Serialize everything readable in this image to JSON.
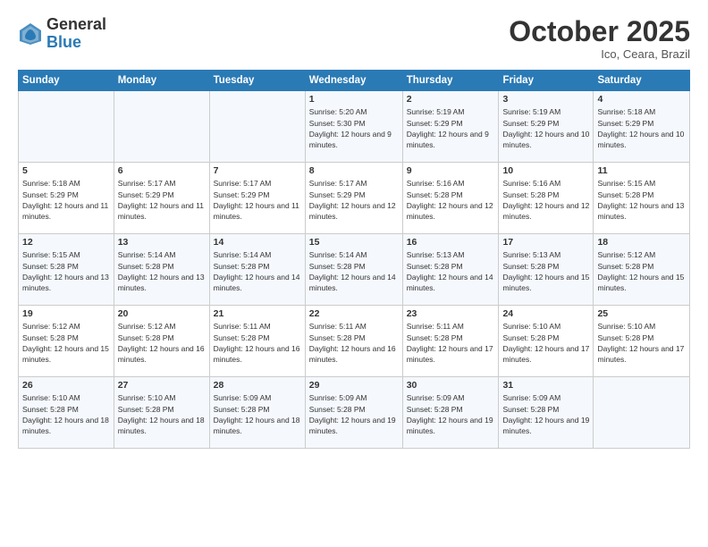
{
  "header": {
    "logo_general": "General",
    "logo_blue": "Blue",
    "month_title": "October 2025",
    "location": "Ico, Ceara, Brazil"
  },
  "weekdays": [
    "Sunday",
    "Monday",
    "Tuesday",
    "Wednesday",
    "Thursday",
    "Friday",
    "Saturday"
  ],
  "rows": [
    [
      {
        "day": "",
        "sunrise": "",
        "sunset": "",
        "daylight": ""
      },
      {
        "day": "",
        "sunrise": "",
        "sunset": "",
        "daylight": ""
      },
      {
        "day": "",
        "sunrise": "",
        "sunset": "",
        "daylight": ""
      },
      {
        "day": "1",
        "sunrise": "Sunrise: 5:20 AM",
        "sunset": "Sunset: 5:30 PM",
        "daylight": "Daylight: 12 hours and 9 minutes."
      },
      {
        "day": "2",
        "sunrise": "Sunrise: 5:19 AM",
        "sunset": "Sunset: 5:29 PM",
        "daylight": "Daylight: 12 hours and 9 minutes."
      },
      {
        "day": "3",
        "sunrise": "Sunrise: 5:19 AM",
        "sunset": "Sunset: 5:29 PM",
        "daylight": "Daylight: 12 hours and 10 minutes."
      },
      {
        "day": "4",
        "sunrise": "Sunrise: 5:18 AM",
        "sunset": "Sunset: 5:29 PM",
        "daylight": "Daylight: 12 hours and 10 minutes."
      }
    ],
    [
      {
        "day": "5",
        "sunrise": "Sunrise: 5:18 AM",
        "sunset": "Sunset: 5:29 PM",
        "daylight": "Daylight: 12 hours and 11 minutes."
      },
      {
        "day": "6",
        "sunrise": "Sunrise: 5:17 AM",
        "sunset": "Sunset: 5:29 PM",
        "daylight": "Daylight: 12 hours and 11 minutes."
      },
      {
        "day": "7",
        "sunrise": "Sunrise: 5:17 AM",
        "sunset": "Sunset: 5:29 PM",
        "daylight": "Daylight: 12 hours and 11 minutes."
      },
      {
        "day": "8",
        "sunrise": "Sunrise: 5:17 AM",
        "sunset": "Sunset: 5:29 PM",
        "daylight": "Daylight: 12 hours and 12 minutes."
      },
      {
        "day": "9",
        "sunrise": "Sunrise: 5:16 AM",
        "sunset": "Sunset: 5:28 PM",
        "daylight": "Daylight: 12 hours and 12 minutes."
      },
      {
        "day": "10",
        "sunrise": "Sunrise: 5:16 AM",
        "sunset": "Sunset: 5:28 PM",
        "daylight": "Daylight: 12 hours and 12 minutes."
      },
      {
        "day": "11",
        "sunrise": "Sunrise: 5:15 AM",
        "sunset": "Sunset: 5:28 PM",
        "daylight": "Daylight: 12 hours and 13 minutes."
      }
    ],
    [
      {
        "day": "12",
        "sunrise": "Sunrise: 5:15 AM",
        "sunset": "Sunset: 5:28 PM",
        "daylight": "Daylight: 12 hours and 13 minutes."
      },
      {
        "day": "13",
        "sunrise": "Sunrise: 5:14 AM",
        "sunset": "Sunset: 5:28 PM",
        "daylight": "Daylight: 12 hours and 13 minutes."
      },
      {
        "day": "14",
        "sunrise": "Sunrise: 5:14 AM",
        "sunset": "Sunset: 5:28 PM",
        "daylight": "Daylight: 12 hours and 14 minutes."
      },
      {
        "day": "15",
        "sunrise": "Sunrise: 5:14 AM",
        "sunset": "Sunset: 5:28 PM",
        "daylight": "Daylight: 12 hours and 14 minutes."
      },
      {
        "day": "16",
        "sunrise": "Sunrise: 5:13 AM",
        "sunset": "Sunset: 5:28 PM",
        "daylight": "Daylight: 12 hours and 14 minutes."
      },
      {
        "day": "17",
        "sunrise": "Sunrise: 5:13 AM",
        "sunset": "Sunset: 5:28 PM",
        "daylight": "Daylight: 12 hours and 15 minutes."
      },
      {
        "day": "18",
        "sunrise": "Sunrise: 5:12 AM",
        "sunset": "Sunset: 5:28 PM",
        "daylight": "Daylight: 12 hours and 15 minutes."
      }
    ],
    [
      {
        "day": "19",
        "sunrise": "Sunrise: 5:12 AM",
        "sunset": "Sunset: 5:28 PM",
        "daylight": "Daylight: 12 hours and 15 minutes."
      },
      {
        "day": "20",
        "sunrise": "Sunrise: 5:12 AM",
        "sunset": "Sunset: 5:28 PM",
        "daylight": "Daylight: 12 hours and 16 minutes."
      },
      {
        "day": "21",
        "sunrise": "Sunrise: 5:11 AM",
        "sunset": "Sunset: 5:28 PM",
        "daylight": "Daylight: 12 hours and 16 minutes."
      },
      {
        "day": "22",
        "sunrise": "Sunrise: 5:11 AM",
        "sunset": "Sunset: 5:28 PM",
        "daylight": "Daylight: 12 hours and 16 minutes."
      },
      {
        "day": "23",
        "sunrise": "Sunrise: 5:11 AM",
        "sunset": "Sunset: 5:28 PM",
        "daylight": "Daylight: 12 hours and 17 minutes."
      },
      {
        "day": "24",
        "sunrise": "Sunrise: 5:10 AM",
        "sunset": "Sunset: 5:28 PM",
        "daylight": "Daylight: 12 hours and 17 minutes."
      },
      {
        "day": "25",
        "sunrise": "Sunrise: 5:10 AM",
        "sunset": "Sunset: 5:28 PM",
        "daylight": "Daylight: 12 hours and 17 minutes."
      }
    ],
    [
      {
        "day": "26",
        "sunrise": "Sunrise: 5:10 AM",
        "sunset": "Sunset: 5:28 PM",
        "daylight": "Daylight: 12 hours and 18 minutes."
      },
      {
        "day": "27",
        "sunrise": "Sunrise: 5:10 AM",
        "sunset": "Sunset: 5:28 PM",
        "daylight": "Daylight: 12 hours and 18 minutes."
      },
      {
        "day": "28",
        "sunrise": "Sunrise: 5:09 AM",
        "sunset": "Sunset: 5:28 PM",
        "daylight": "Daylight: 12 hours and 18 minutes."
      },
      {
        "day": "29",
        "sunrise": "Sunrise: 5:09 AM",
        "sunset": "Sunset: 5:28 PM",
        "daylight": "Daylight: 12 hours and 19 minutes."
      },
      {
        "day": "30",
        "sunrise": "Sunrise: 5:09 AM",
        "sunset": "Sunset: 5:28 PM",
        "daylight": "Daylight: 12 hours and 19 minutes."
      },
      {
        "day": "31",
        "sunrise": "Sunrise: 5:09 AM",
        "sunset": "Sunset: 5:28 PM",
        "daylight": "Daylight: 12 hours and 19 minutes."
      },
      {
        "day": "",
        "sunrise": "",
        "sunset": "",
        "daylight": ""
      }
    ]
  ]
}
